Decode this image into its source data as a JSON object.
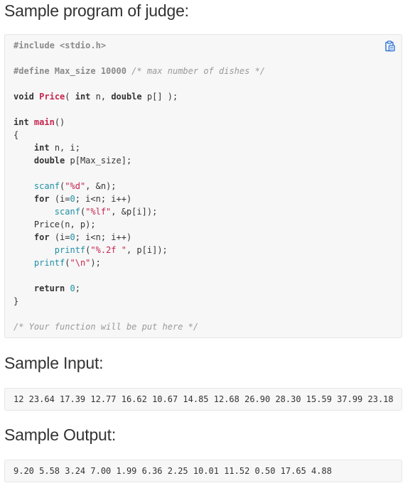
{
  "sections": {
    "judge_title": "Sample program of judge:",
    "input_title": "Sample Input:",
    "output_title": "Sample Output:"
  },
  "code": {
    "include": "#include <stdio.h>",
    "define_directive": "#define Max_size 10000 ",
    "define_comment": "/* max number of dishes */",
    "kw_void": "void",
    "fn_price": "Price",
    "decl_rest_1": "( ",
    "kw_int": "int",
    "decl_rest_2": " n, ",
    "kw_double": "double",
    "decl_rest_3": " p[] );",
    "fn_main": "main",
    "main_parens": "()",
    "brace_open": "{",
    "vars_int_rest": " n, i;",
    "vars_double_rest": " p[Max_size];",
    "scanf": "scanf",
    "fmt_d": "\"%d\"",
    "scanf_1_rest": ", &n);",
    "kw_for": "for",
    "for_open": " (i=",
    "zero": "0",
    "for_close": "; i<n; i++)",
    "fmt_lf": "\"%lf\"",
    "scanf_2_rest": ", &p[i]);",
    "price_call": "Price(n, p);",
    "printf": "printf",
    "fmt_2f": "\"%.2f \"",
    "printf_1_rest": ", p[i]);",
    "fmt_nl": "\"\\n\"",
    "printf_2_rest": ");",
    "kw_return": "return",
    "return_rest": ";",
    "brace_close": "}",
    "footer_comment": "/* Your function will be put here */"
  },
  "sample_input": "12 23.64 17.39 12.77 16.62 10.67 14.85 12.68 26.90 28.30 15.59 37.99 23.18",
  "sample_output": "9.20 5.58 3.24 7.00 1.99 6.36 2.25 10.01 11.52 0.50 17.65 4.88",
  "icons": {
    "copy": "copy-clipboard-icon"
  }
}
